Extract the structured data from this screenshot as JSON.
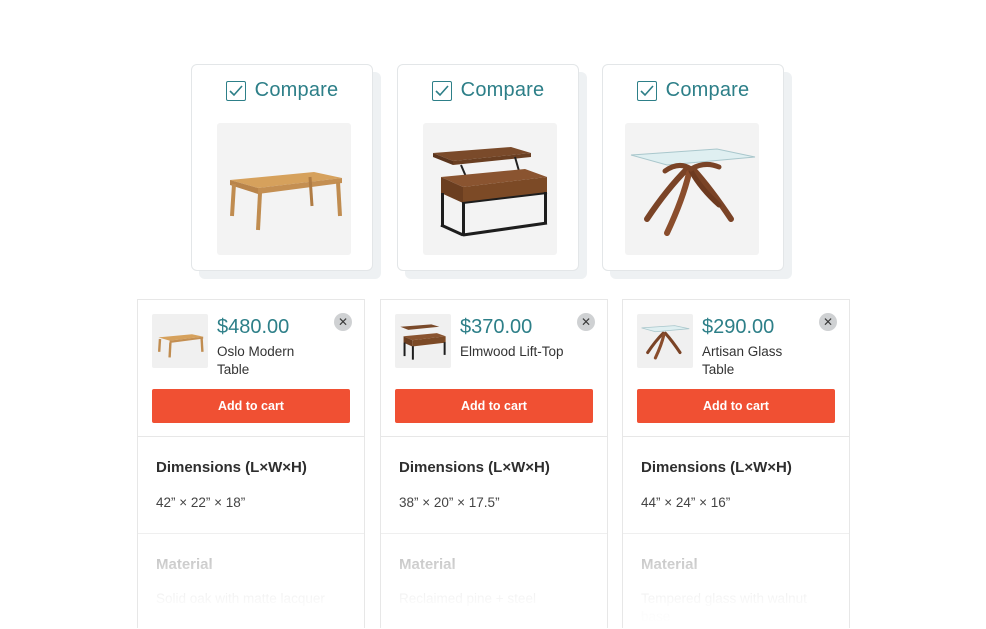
{
  "compare_cards": [
    {
      "label": "Compare",
      "checked": true,
      "image": "oak-table"
    },
    {
      "label": "Compare",
      "checked": true,
      "image": "lift-top-table"
    },
    {
      "label": "Compare",
      "checked": true,
      "image": "glass-table"
    }
  ],
  "products": [
    {
      "price": "$480.00",
      "name": "Oslo Modern Table",
      "add_to_cart": "Add to cart",
      "remove_icon": "close-icon",
      "dimensions_title": "Dimensions (L×W×H)",
      "dimensions_value": "42” × 22” × 18”",
      "material_title": "Material",
      "material_value": "Solid oak with matte lacquer"
    },
    {
      "price": "$370.00",
      "name": "Elmwood Lift-Top",
      "add_to_cart": "Add to cart",
      "remove_icon": "close-icon",
      "dimensions_title": "Dimensions (L×W×H)",
      "dimensions_value": "38” × 20” × 17.5”",
      "material_title": "Material",
      "material_value": "Reclaimed pine + steel"
    },
    {
      "price": "$290.00",
      "name": "Artisan Glass Table",
      "add_to_cart": "Add to cart",
      "remove_icon": "close-icon",
      "dimensions_title": "Dimensions (L×W×H)",
      "dimensions_value": "44” × 24” × 16”",
      "material_title": "Material",
      "material_value": "Tempered glass with walnut base"
    }
  ],
  "colors": {
    "accent": "#2d7f88",
    "cta": "#f05033"
  }
}
